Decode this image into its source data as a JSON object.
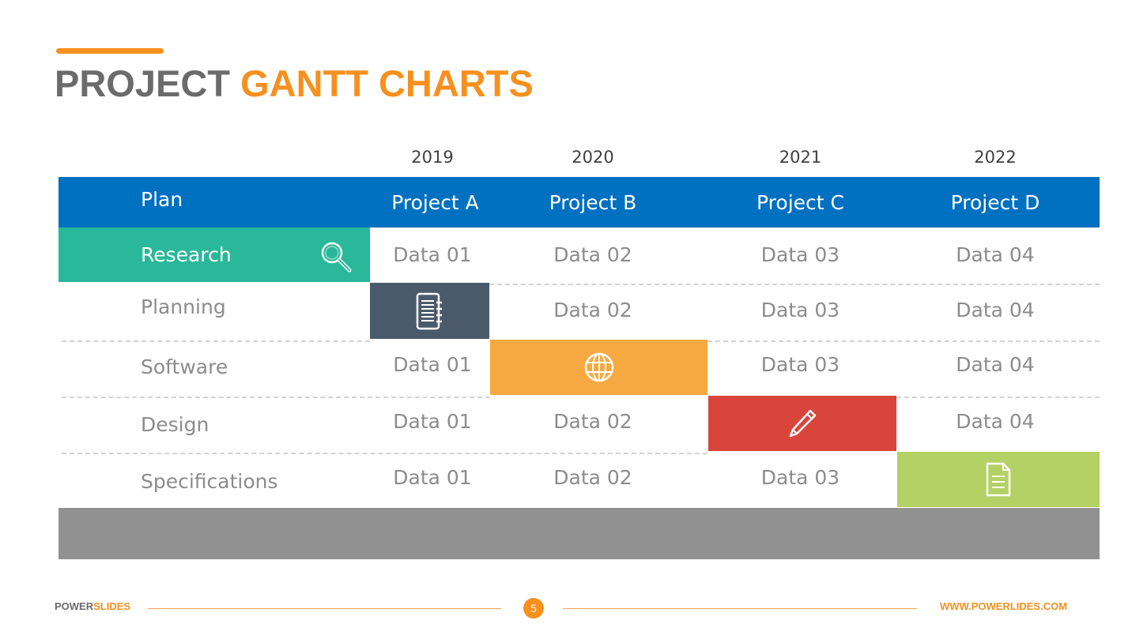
{
  "title": {
    "part1": "PROJECT",
    "part2": "GANTT CHARTS"
  },
  "colors": {
    "accent": "#f7901e",
    "header": "#0070c0",
    "research": "#29b899",
    "planning": "#4a5a6a",
    "software": "#f7a941",
    "design": "#d9453b",
    "specifications": "#b3d165",
    "footer_bar": "#919191",
    "text_gray": "#8c8c8c"
  },
  "years": [
    "2019",
    "2020",
    "2021",
    "2022"
  ],
  "header": {
    "plan_label": "Plan",
    "projects": [
      "Project A",
      "Project B",
      "Project C",
      "Project D"
    ]
  },
  "rows": [
    {
      "label": "Research",
      "icon": "magnifier-icon",
      "highlight_column": "Plan",
      "cells": [
        "Data 01",
        "Data 02",
        "Data 03",
        "Data 04"
      ]
    },
    {
      "label": "Planning",
      "icon": "notebook-icon",
      "highlight_column": "Project A",
      "cells": [
        "",
        "Data 02",
        "Data 03",
        "Data 04"
      ]
    },
    {
      "label": "Software",
      "icon": "globe-icon",
      "highlight_column": "Project B",
      "cells": [
        "Data 01",
        "",
        "Data 03",
        "Data 04"
      ]
    },
    {
      "label": "Design",
      "icon": "pencil-icon",
      "highlight_column": "Project C",
      "cells": [
        "Data 01",
        "Data 02",
        "",
        "Data 04"
      ]
    },
    {
      "label": "Specifications",
      "icon": "document-icon",
      "highlight_column": "Project D",
      "cells": [
        "Data 01",
        "Data 02",
        "Data 03",
        ""
      ]
    }
  ],
  "footer": {
    "brand_part1": "POWER",
    "brand_part2": "SLIDES",
    "page_number": "5",
    "url": "WWW.POWERLIDES.COM"
  }
}
